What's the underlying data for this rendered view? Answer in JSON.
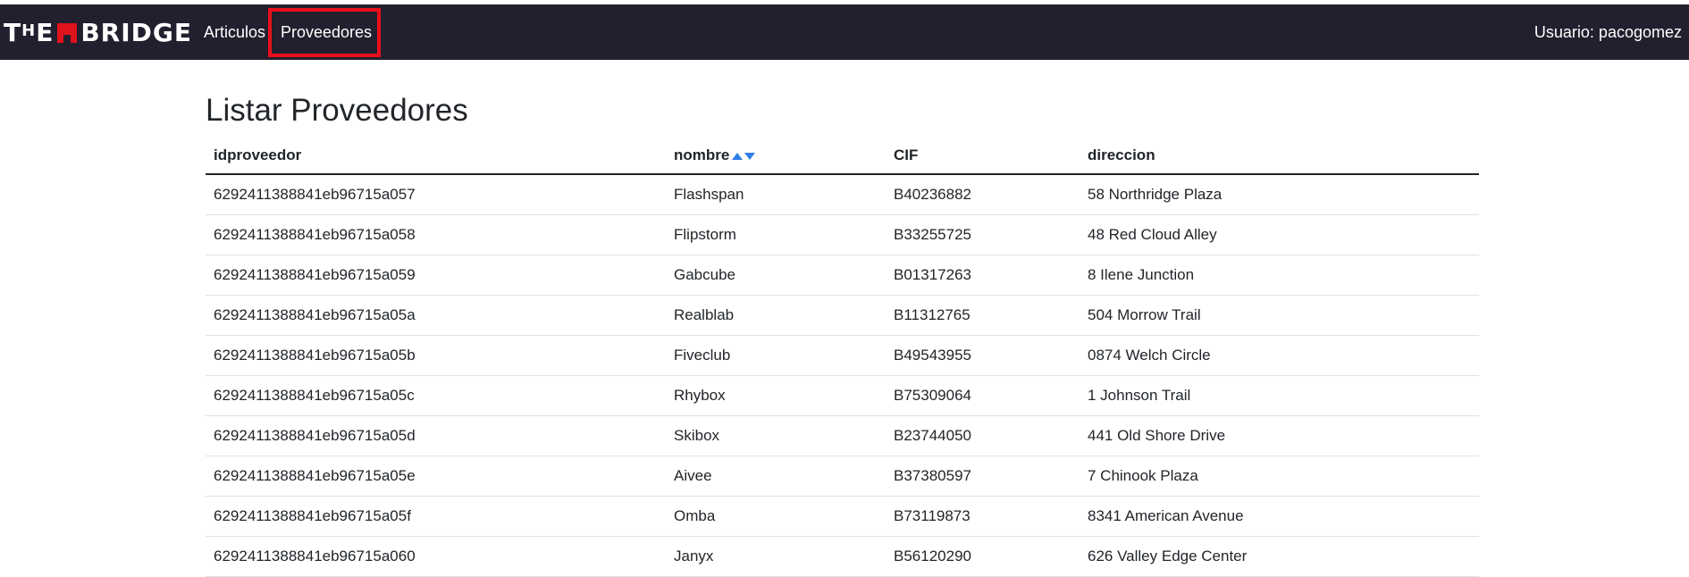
{
  "navbar": {
    "brand": {
      "part1": "T",
      "part2": "H",
      "part3": "E",
      "part4": "BRIDGE"
    },
    "links": [
      {
        "label": "Articulos"
      },
      {
        "label": "Proveedores"
      }
    ],
    "user": "Usuario: pacogomez"
  },
  "page": {
    "title": "Listar Proveedores"
  },
  "table": {
    "headers": {
      "id": "idproveedor",
      "nombre": "nombre",
      "cif": "CIF",
      "direccion": "direccion"
    },
    "rows": [
      {
        "id": "6292411388841eb96715a057",
        "nombre": "Flashspan",
        "cif": "B40236882",
        "direccion": "58 Northridge Plaza"
      },
      {
        "id": "6292411388841eb96715a058",
        "nombre": "Flipstorm",
        "cif": "B33255725",
        "direccion": "48 Red Cloud Alley"
      },
      {
        "id": "6292411388841eb96715a059",
        "nombre": "Gabcube",
        "cif": "B01317263",
        "direccion": "8 Ilene Junction"
      },
      {
        "id": "6292411388841eb96715a05a",
        "nombre": "Realblab",
        "cif": "B11312765",
        "direccion": "504 Morrow Trail"
      },
      {
        "id": "6292411388841eb96715a05b",
        "nombre": "Fiveclub",
        "cif": "B49543955",
        "direccion": "0874 Welch Circle"
      },
      {
        "id": "6292411388841eb96715a05c",
        "nombre": "Rhybox",
        "cif": "B75309064",
        "direccion": "1 Johnson Trail"
      },
      {
        "id": "6292411388841eb96715a05d",
        "nombre": "Skibox",
        "cif": "B23744050",
        "direccion": "441 Old Shore Drive"
      },
      {
        "id": "6292411388841eb96715a05e",
        "nombre": "Aivee",
        "cif": "B37380597",
        "direccion": "7 Chinook Plaza"
      },
      {
        "id": "6292411388841eb96715a05f",
        "nombre": "Omba",
        "cif": "B73119873",
        "direccion": "8341 American Avenue"
      },
      {
        "id": "6292411388841eb96715a060",
        "nombre": "Janyx",
        "cif": "B56120290",
        "direccion": "626 Valley Edge Center"
      }
    ]
  },
  "colors": {
    "navbar_bg": "#221f2e",
    "brand_red": "#e0121c",
    "highlight": "#e8101b",
    "sort_arrow": "#2f7fe6"
  },
  "icons": {
    "sort_asc": "sort-asc-icon",
    "sort_desc": "sort-desc-icon"
  }
}
